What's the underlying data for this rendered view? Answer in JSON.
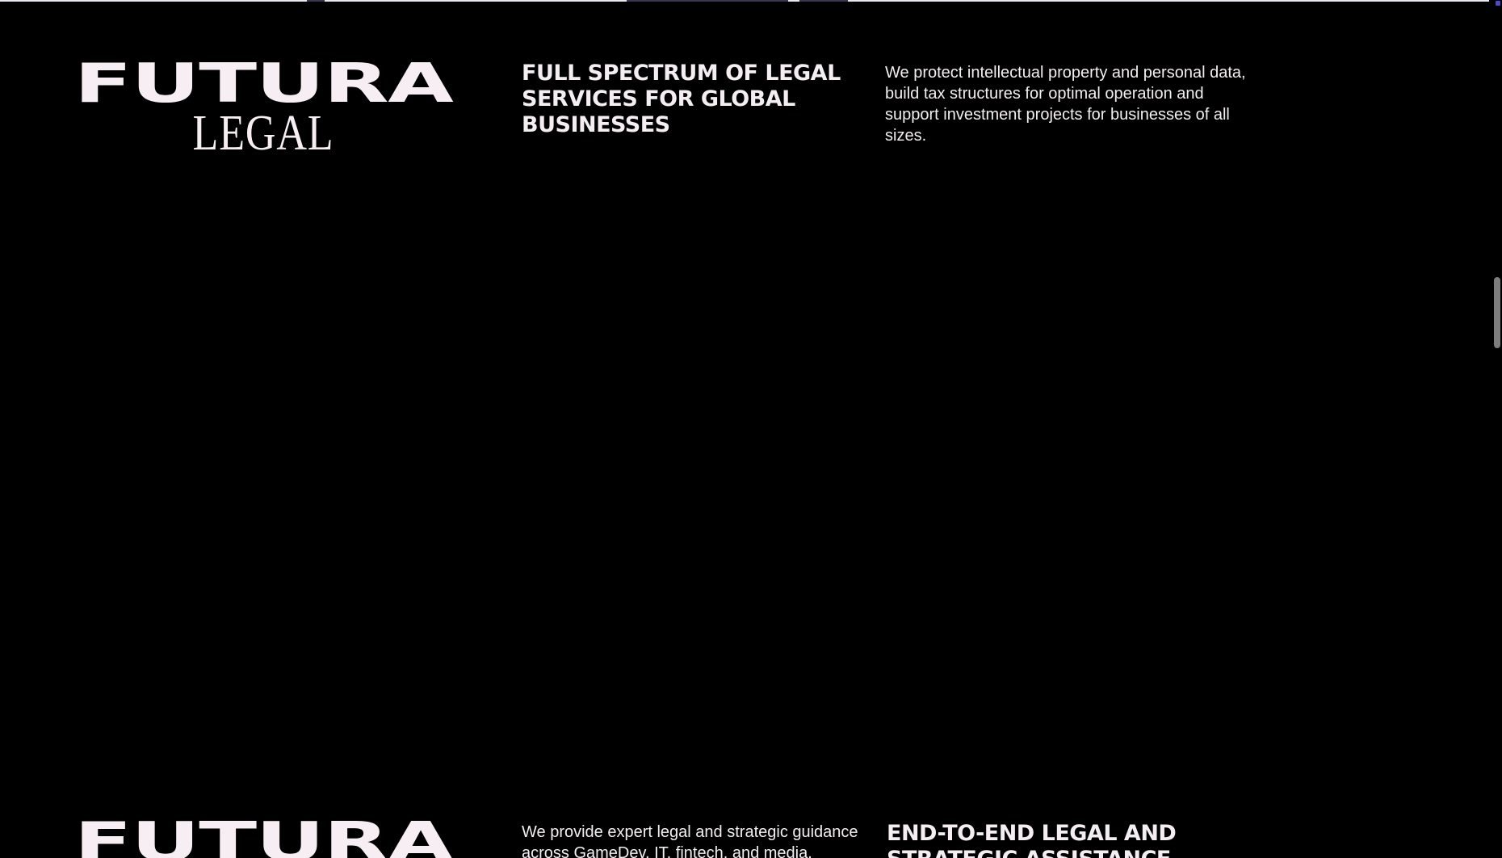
{
  "section1": {
    "logo_main": "FUTURA",
    "logo_sub": "LEGAL",
    "heading": "FULL SPECTRUM OF LEGAL SERVICES FOR GLOBAL BUSINESSES",
    "paragraph": "We protect intellectual property and personal data, build tax structures for optimal operation and support investment projects for businesses of all sizes."
  },
  "section2": {
    "logo_main": "FUTURA",
    "paragraph": "We provide expert legal and strategic guidance across GameDev, IT, fintech, and media, assisting",
    "heading": "END-TO-END LEGAL AND STRATEGIC ASSISTANCE"
  },
  "colors": {
    "background": "#000000",
    "text": "#f3eef1",
    "scroll_thumb": "#7d7d7d"
  },
  "icons": {
    "corner": "small-square-icon"
  }
}
